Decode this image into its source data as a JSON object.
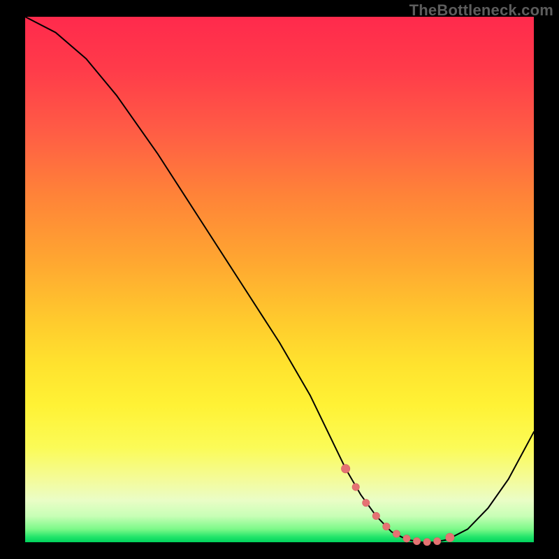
{
  "watermark": "TheBottleneck.com",
  "colors": {
    "background": "#000000",
    "curve_stroke": "#000000",
    "marker_fill": "#e57373",
    "marker_stroke": "#d46464"
  },
  "chart_data": {
    "type": "line",
    "title": "",
    "xlabel": "",
    "ylabel": "",
    "xlim": [
      0,
      100
    ],
    "ylim": [
      0,
      100
    ],
    "series": [
      {
        "name": "curve",
        "x": [
          0,
          6,
          12,
          18,
          26,
          34,
          42,
          50,
          56,
          60,
          63,
          66,
          69,
          72,
          75,
          78,
          80.5,
          83,
          87,
          91,
          95,
          100
        ],
        "values": [
          100,
          97,
          92,
          85,
          74,
          62,
          50,
          38,
          28,
          20,
          14,
          9,
          5,
          2,
          0.5,
          0,
          0,
          0.5,
          2.5,
          6.5,
          12,
          21
        ]
      }
    ],
    "markers": {
      "name": "highlight",
      "x": [
        63,
        65,
        67,
        69,
        71,
        73,
        75,
        77,
        79,
        81,
        83.5
      ],
      "values": [
        14,
        10.5,
        7.5,
        5,
        3,
        1.6,
        0.7,
        0.2,
        0.05,
        0.2,
        0.9
      ]
    }
  }
}
